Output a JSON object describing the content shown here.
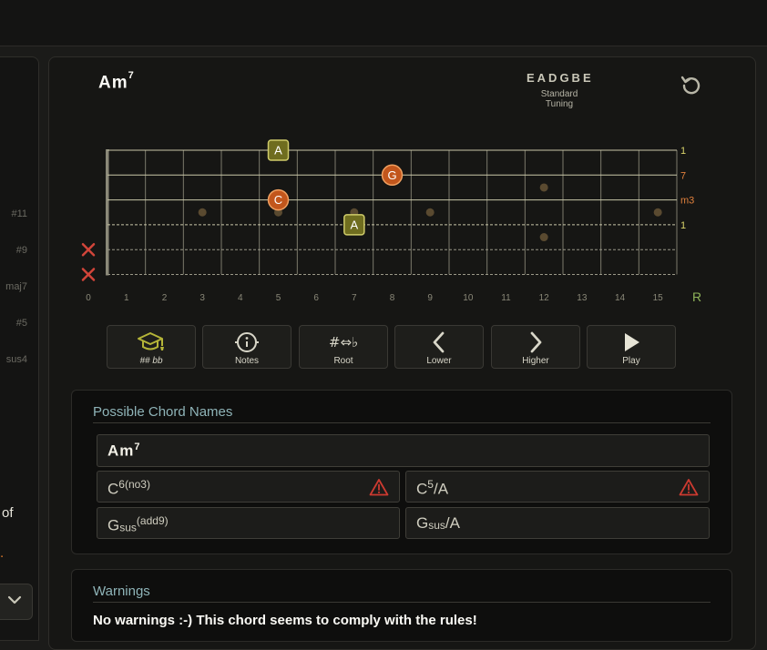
{
  "sidebar": {
    "labels": [
      "#11",
      "#9",
      "maj7",
      "#5",
      "sus4"
    ],
    "partial_text_1": "of",
    "partial_text_2": "."
  },
  "chord": {
    "root": "Am",
    "ext": "7"
  },
  "tuning": {
    "notes": "EADGBE",
    "label": "Standard Tuning"
  },
  "fretboard": {
    "fret_numbers": [
      "0",
      "1",
      "2",
      "3",
      "4",
      "5",
      "6",
      "7",
      "8",
      "9",
      "10",
      "11",
      "12",
      "13",
      "14",
      "15"
    ],
    "root_label": "R",
    "interval_labels": [
      "1",
      "7",
      "m3",
      "1"
    ],
    "muted_strings": [
      5,
      6
    ],
    "inlay_dots_single": [
      3,
      5,
      7,
      9,
      15
    ],
    "inlay_dots_double": 12,
    "notes": [
      {
        "string": 1,
        "fret": 5,
        "name": "A",
        "role": "root"
      },
      {
        "string": 2,
        "fret": 8,
        "name": "G",
        "role": "other"
      },
      {
        "string": 3,
        "fret": 5,
        "name": "C",
        "role": "other"
      },
      {
        "string": 4,
        "fret": 7,
        "name": "A",
        "role": "root"
      }
    ],
    "colors": {
      "root": "#6f6d1f",
      "other": "#c2561c",
      "interval_root": "#d9d46a",
      "interval_other": "#e0803c",
      "muted": "#d2453a"
    }
  },
  "toolbar": [
    {
      "name": "accidentals-button",
      "icon": "graduation-cap-icon",
      "label": "##   bb"
    },
    {
      "name": "notes-button",
      "icon": "info-icon",
      "label": "Notes"
    },
    {
      "name": "root-button",
      "icon": "sharp-flat-icon",
      "icon_text": "#⇔♭",
      "label": "Root"
    },
    {
      "name": "lower-button",
      "icon": "chevron-left-icon",
      "label": "Lower"
    },
    {
      "name": "higher-button",
      "icon": "chevron-right-icon",
      "label": "Higher"
    },
    {
      "name": "play-button",
      "icon": "play-icon",
      "label": "Play"
    }
  ],
  "possible_names": {
    "title": "Possible Chord Names",
    "primary": {
      "base": "Am",
      "sup": "7"
    },
    "alternatives": [
      {
        "base": "C",
        "sup": "6(no3)",
        "suffix": "",
        "warning": true
      },
      {
        "base": "C",
        "sup": "5",
        "suffix": "/A",
        "warning": true
      },
      {
        "base": "G",
        "sub": "sus",
        "sup": "(add9)",
        "suffix": "",
        "warning": false
      },
      {
        "base": "G",
        "sub": "sus",
        "sup": "",
        "suffix": "/A",
        "warning": false
      }
    ]
  },
  "warnings": {
    "title": "Warnings",
    "text": "No warnings :-) This chord seems to comply with the rules!"
  }
}
